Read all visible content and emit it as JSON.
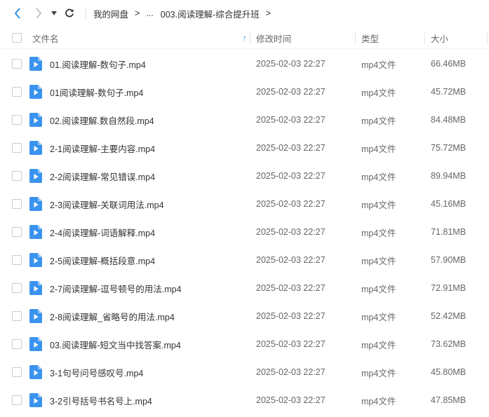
{
  "breadcrumb": {
    "root": "我的网盘",
    "ellipsis": "...",
    "current": "003.阅读理解-综合提升班",
    "separator": ">"
  },
  "header": {
    "name": "文件名",
    "modified": "修改时间",
    "type": "类型",
    "size": "大小",
    "sort_arrow": "↑"
  },
  "colors": {
    "accent": "#1e88e5",
    "file_icon": "#3a93ee"
  },
  "files": [
    {
      "name": "01.阅读理解-数句子.mp4",
      "modified": "2025-02-03 22:27",
      "type": "mp4文件",
      "size": "66.46MB"
    },
    {
      "name": "01阅读理解-数句子.mp4",
      "modified": "2025-02-03 22:27",
      "type": "mp4文件",
      "size": "45.72MB"
    },
    {
      "name": "02.阅读理解.数自然段.mp4",
      "modified": "2025-02-03 22:27",
      "type": "mp4文件",
      "size": "84.48MB"
    },
    {
      "name": "2-1阅读理解-主要内容.mp4",
      "modified": "2025-02-03 22:27",
      "type": "mp4文件",
      "size": "75.72MB"
    },
    {
      "name": "2-2阅读理解-常见错误.mp4",
      "modified": "2025-02-03 22:27",
      "type": "mp4文件",
      "size": "89.94MB"
    },
    {
      "name": "2-3阅读理解-关联词用法.mp4",
      "modified": "2025-02-03 22:27",
      "type": "mp4文件",
      "size": "45.16MB"
    },
    {
      "name": "2-4阅读理解-词语解释.mp4",
      "modified": "2025-02-03 22:27",
      "type": "mp4文件",
      "size": "71.81MB"
    },
    {
      "name": "2-5阅读理解-概括段意.mp4",
      "modified": "2025-02-03 22:27",
      "type": "mp4文件",
      "size": "57.90MB"
    },
    {
      "name": "2-7阅读理解-逗号顿号的用法.mp4",
      "modified": "2025-02-03 22:27",
      "type": "mp4文件",
      "size": "72.91MB"
    },
    {
      "name": "2-8阅读理解_省略号的用法.mp4",
      "modified": "2025-02-03 22:27",
      "type": "mp4文件",
      "size": "52.42MB"
    },
    {
      "name": "03.阅读理解-短文当中找答案.mp4",
      "modified": "2025-02-03 22:27",
      "type": "mp4文件",
      "size": "73.62MB"
    },
    {
      "name": "3-1句号问号感叹号.mp4",
      "modified": "2025-02-03 22:27",
      "type": "mp4文件",
      "size": "45.80MB"
    },
    {
      "name": "3-2引号括号书名号上.mp4",
      "modified": "2025-02-03 22:27",
      "type": "mp4文件",
      "size": "47.85MB"
    }
  ]
}
